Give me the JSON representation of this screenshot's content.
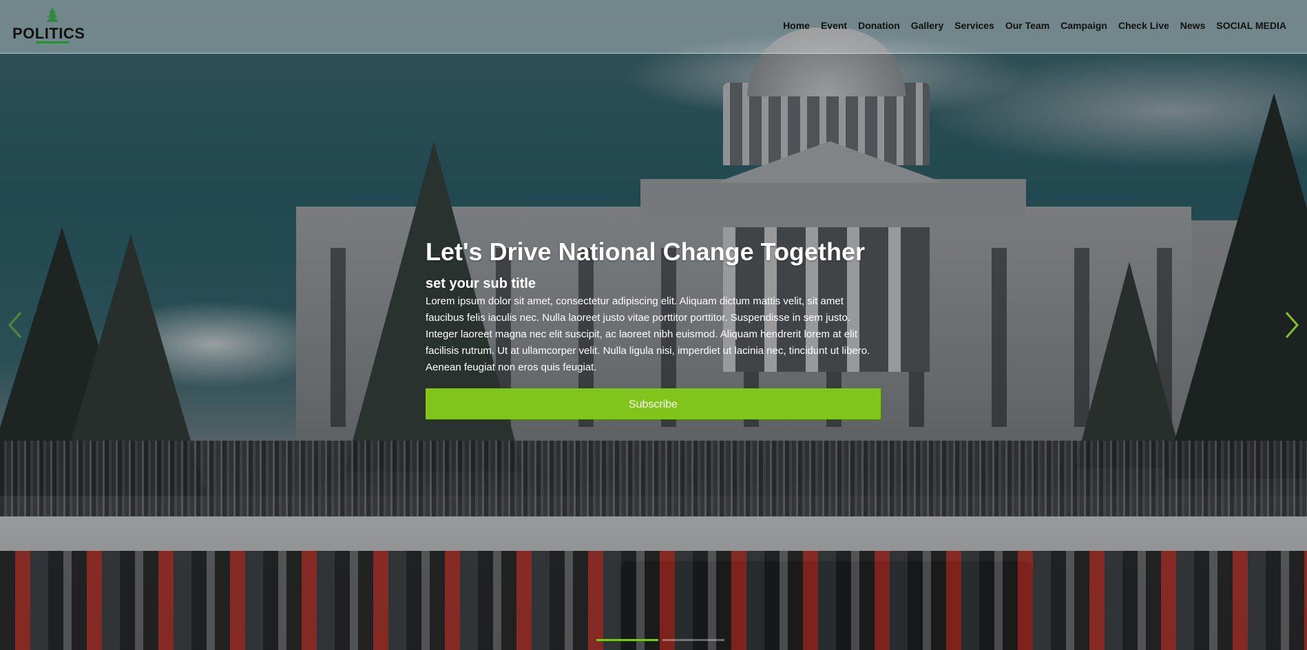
{
  "brand": {
    "name": "POLITICS",
    "logo_icon": "capitol-tree-icon",
    "accent": "#2e8b3e"
  },
  "nav": {
    "items": [
      {
        "label": "Home"
      },
      {
        "label": "Event"
      },
      {
        "label": "Donation"
      },
      {
        "label": "Gallery"
      },
      {
        "label": "Services"
      },
      {
        "label": "Our Team"
      },
      {
        "label": "Campaign"
      },
      {
        "label": "Check Live"
      },
      {
        "label": "News"
      },
      {
        "label": "SOCIAL MEDIA"
      }
    ]
  },
  "hero": {
    "title": "Let's Drive National Change Together",
    "subtitle": "set your sub title",
    "body": "Lorem ipsum dolor sit amet, consectetur adipiscing elit. Aliquam dictum mattis velit, sit amet faucibus felis iaculis nec. Nulla laoreet justo vitae porttitor porttitor. Suspendisse in sem justo. Integer laoreet magna nec elit suscipit, ac laoreet nibh euismod. Aliquam hendrerit lorem at elit facilisis rutrum. Ut at ullamcorper velit. Nulla ligula nisi, imperdiet ut lacinia nec, tincidunt ut libero. Aenean feugiat non eros quis feugiat.",
    "cta_label": "Subscribe",
    "cta_color": "#80c41c"
  },
  "carousel": {
    "prev_icon": "chevron-left-icon",
    "next_icon": "chevron-right-icon",
    "active_color": "#80c41c"
  }
}
